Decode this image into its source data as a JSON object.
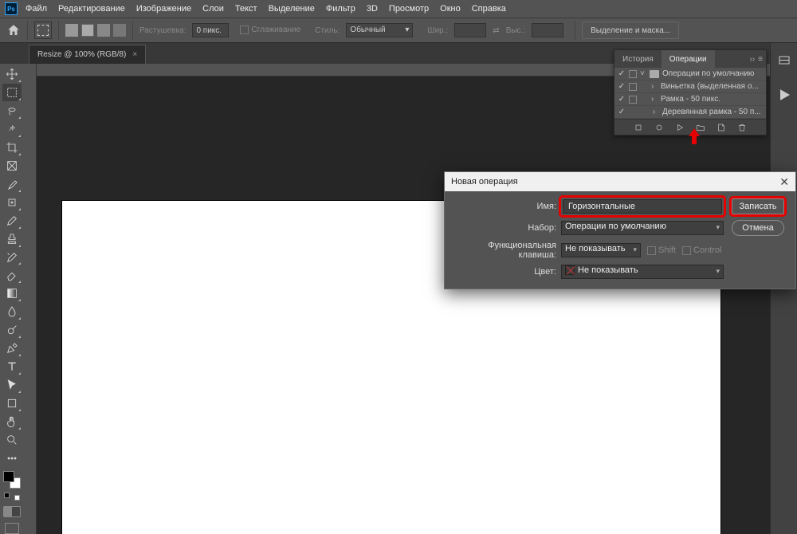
{
  "app": {
    "logo": "Ps"
  },
  "menu": [
    "Файл",
    "Редактирование",
    "Изображение",
    "Слои",
    "Текст",
    "Выделение",
    "Фильтр",
    "3D",
    "Просмотр",
    "Окно",
    "Справка"
  ],
  "options": {
    "feather_label": "Растушевка:",
    "feather_value": "0 пикс.",
    "antialias": "Сглаживание",
    "style_label": "Стиль:",
    "style_value": "Обычный",
    "width_label": "Шир.:",
    "height_label": "Выс.:",
    "select_mask": "Выделение и маска..."
  },
  "doc_tab": {
    "title": "Resize @ 100% (RGB/8)"
  },
  "tools": [
    "move",
    "marquee",
    "lasso",
    "wand",
    "crop",
    "frame",
    "eyedrop",
    "patch",
    "brush",
    "stamp",
    "history",
    "eraser",
    "gradient",
    "blur",
    "dodge",
    "pen",
    "type",
    "path",
    "shape",
    "hand",
    "zoom",
    "more"
  ],
  "actions_panel": {
    "tab_history": "История",
    "tab_actions": "Операции",
    "rows": [
      {
        "check": "✓",
        "stop": true,
        "exp": "˅",
        "folder": true,
        "text": "Операции по умолчанию"
      },
      {
        "check": "✓",
        "stop": true,
        "exp": "›",
        "folder": false,
        "text": "Виньетка (выделенная о..."
      },
      {
        "check": "✓",
        "stop": true,
        "exp": "›",
        "folder": false,
        "text": "Рамка - 50 пикс."
      },
      {
        "check": "✓",
        "stop": false,
        "exp": "›",
        "folder": false,
        "text": "Деревянная рамка - 50 п..."
      }
    ]
  },
  "dialog": {
    "title": "Новая операция",
    "name_label": "Имя:",
    "name_value": "Горизонтальные",
    "set_label": "Набор:",
    "set_value": "Операции по умолчанию",
    "fnkey_label": "Функциональная клавиша:",
    "fnkey_value": "Не показывать",
    "shift": "Shift",
    "control": "Control",
    "color_label": "Цвет:",
    "color_value": "Не показывать",
    "record": "Записать",
    "cancel": "Отмена"
  }
}
